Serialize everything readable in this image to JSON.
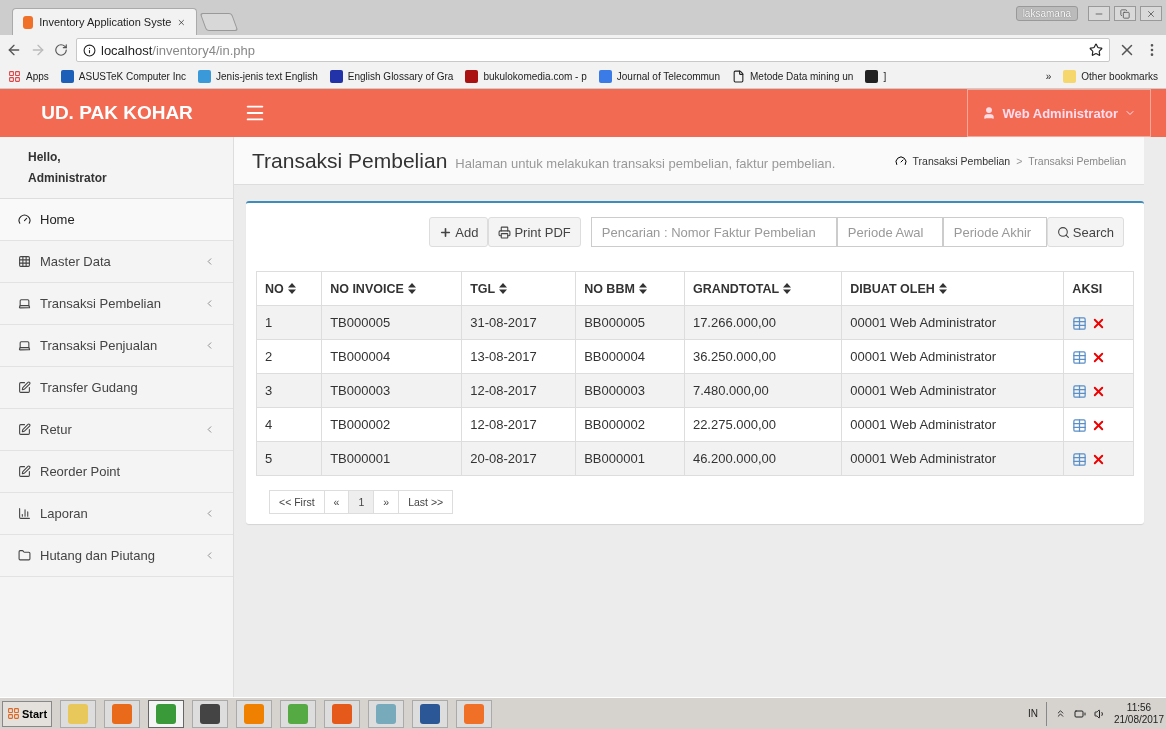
{
  "browser": {
    "tab_title": "Inventory Application Syste",
    "profile": "laksamana",
    "url_host": "localhost",
    "url_path": "/inventory4/in.php",
    "bookmarks": [
      {
        "label": "Apps",
        "kind": "apps"
      },
      {
        "label": "ASUSTeK Computer Inc",
        "kind": "asus"
      },
      {
        "label": "Jenis-jenis text English",
        "kind": "wp"
      },
      {
        "label": "English Glossary of Gra",
        "kind": "ue"
      },
      {
        "label": "bukulokomedia.com - p",
        "kind": "buku"
      },
      {
        "label": "Journal of Telecommun",
        "kind": "journal"
      },
      {
        "label": "Metode Data mining un",
        "kind": "doc"
      },
      {
        "label": "]",
        "kind": "np"
      }
    ],
    "more": "»",
    "other_bookmarks": "Other bookmarks"
  },
  "app": {
    "brand": "UD. PAK KOHAR",
    "user_menu": "Web Administrator",
    "sidebar": {
      "greeting": [
        "Hello,",
        "Administrator"
      ],
      "items": [
        {
          "label": "Home",
          "kind": "home",
          "selected": true,
          "submenu": false
        },
        {
          "label": "Master Data",
          "kind": "grid",
          "selected": false,
          "submenu": true
        },
        {
          "label": "Transaksi Pembelian",
          "kind": "laptop",
          "selected": false,
          "submenu": true
        },
        {
          "label": "Transaksi Penjualan",
          "kind": "laptop",
          "selected": false,
          "submenu": true
        },
        {
          "label": "Transfer Gudang",
          "kind": "edit",
          "selected": false,
          "submenu": false
        },
        {
          "label": "Retur",
          "kind": "edit",
          "selected": false,
          "submenu": true
        },
        {
          "label": "Reorder Point",
          "kind": "edit",
          "selected": false,
          "submenu": false
        },
        {
          "label": "Laporan",
          "kind": "chart",
          "selected": false,
          "submenu": true
        },
        {
          "label": "Hutang dan Piutang",
          "kind": "folder",
          "selected": false,
          "submenu": true
        }
      ]
    },
    "page_title": "Transaksi Pembelian",
    "page_subtitle": "Halaman untuk melakukan transaksi pembelian, faktur pembelian.",
    "breadcrumbs": [
      {
        "label": "Transaksi Pembelian",
        "selected": false
      },
      {
        "label": "Transaksi Pembelian",
        "selected": true
      }
    ],
    "breadcrumb_separator": ">",
    "toolbar": {
      "add": "Add",
      "print": "Print PDF",
      "search_placeholder": "Pencarian : Nomor Faktur Pembelian",
      "start_placeholder": "Periode Awal",
      "end_placeholder": "Periode Akhir",
      "search": "Search"
    },
    "table": {
      "columns": [
        {
          "label": "NO",
          "sortable": true
        },
        {
          "label": "NO INVOICE",
          "sortable": true
        },
        {
          "label": "TGL",
          "sortable": true
        },
        {
          "label": "NO BBM",
          "sortable": true
        },
        {
          "label": "GRANDTOTAL",
          "sortable": true
        },
        {
          "label": "DIBUAT OLEH",
          "sortable": true
        },
        {
          "label": "AKSI",
          "sortable": false
        }
      ],
      "rows": [
        [
          "1",
          "TB000005",
          "31-08-2017",
          "BB000005",
          "17.266.000,00",
          "00001 Web Administrator"
        ],
        [
          "2",
          "TB000004",
          "13-08-2017",
          "BB000004",
          "36.250.000,00",
          "00001 Web Administrator"
        ],
        [
          "3",
          "TB000003",
          "12-08-2017",
          "BB000003",
          "7.480.000,00",
          "00001 Web Administrator"
        ],
        [
          "4",
          "TB000002",
          "12-08-2017",
          "BB000002",
          "22.275.000,00",
          "00001 Web Administrator"
        ],
        [
          "5",
          "TB000001",
          "20-08-2017",
          "BB000001",
          "46.200.000,00",
          "00001 Web Administrator"
        ]
      ]
    },
    "pagination": [
      {
        "label": "<< First",
        "selected": false
      },
      {
        "label": "«",
        "selected": false
      },
      {
        "label": "1",
        "selected": true
      },
      {
        "label": "»",
        "selected": false
      },
      {
        "label": "Last >>",
        "selected": false
      }
    ]
  },
  "taskbar": {
    "start": "Start",
    "apps": [
      {
        "kind": "folder",
        "selected": false
      },
      {
        "kind": "media",
        "selected": false
      },
      {
        "kind": "chrome",
        "selected": true
      },
      {
        "kind": "sublime",
        "selected": false
      },
      {
        "kind": "vlc",
        "selected": false
      },
      {
        "kind": "stack",
        "selected": false
      },
      {
        "kind": "foxit",
        "selected": false
      },
      {
        "kind": "windows",
        "selected": false
      },
      {
        "kind": "word",
        "selected": false
      },
      {
        "kind": "xampp",
        "selected": false
      }
    ],
    "language": "IN",
    "time": "11:56",
    "date": "21/08/2017"
  }
}
